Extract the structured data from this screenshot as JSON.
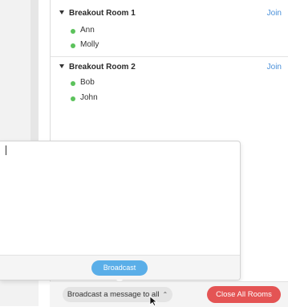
{
  "rooms": [
    {
      "title": "Breakout Room 1",
      "join_label": "Join",
      "members": [
        "Ann",
        "Molly"
      ]
    },
    {
      "title": "Breakout Room 2",
      "join_label": "Join",
      "members": [
        "Bob",
        "John"
      ]
    }
  ],
  "broadcast_popup": {
    "message_value": "",
    "broadcast_button_label": "Broadcast"
  },
  "bottom_bar": {
    "broadcast_menu_label": "Broadcast a message to all",
    "close_all_label": "Close All Rooms"
  },
  "colors": {
    "accent_blue": "#5aaee8",
    "join_blue": "#4a90d9",
    "danger_red": "#e45454",
    "status_green": "#5cc25c"
  },
  "icons": {
    "room_toggle": "caret-down-icon",
    "member_status": "status-dot-icon",
    "menu_chevron": "chevron-up-icon",
    "pointer": "mouse-pointer-icon"
  }
}
